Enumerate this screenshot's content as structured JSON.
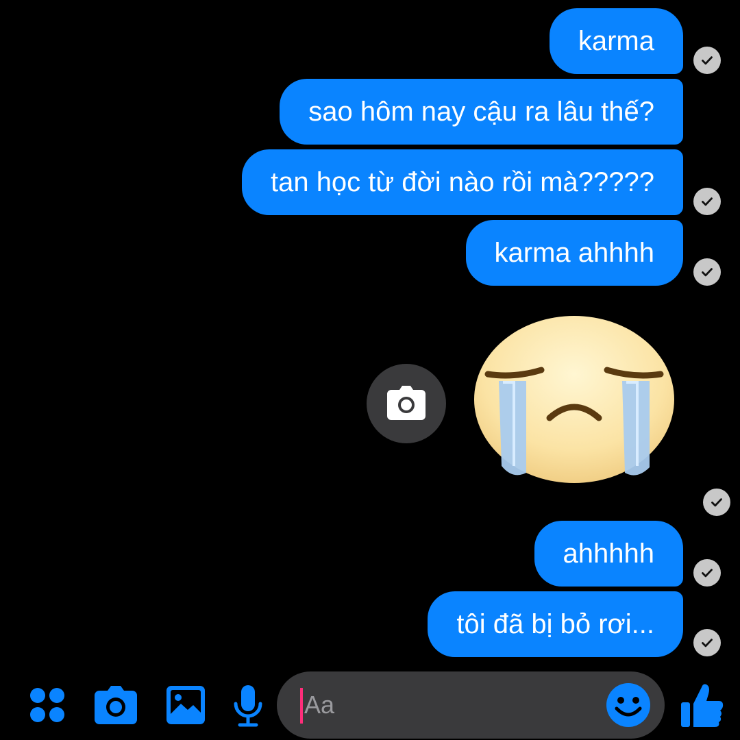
{
  "colors": {
    "background": "#000000",
    "bubble": "#0a84ff",
    "accent": "#0a84ff",
    "receipt": "#c8c8c8",
    "input_bg": "#3a3a3c"
  },
  "messages": [
    {
      "text": "karma"
    },
    {
      "text": "sao hôm nay cậu ra lâu thế?"
    },
    {
      "text": "tan học từ đời nào rồi mà?????"
    },
    {
      "text": "karma ahhhh"
    },
    {
      "text": "ahhhhh"
    },
    {
      "text": "tôi đã bị bỏ rơi..."
    }
  ],
  "sticker": {
    "icon": "crying-face-sticker"
  },
  "camera_overlay": {
    "icon": "camera-icon"
  },
  "composer": {
    "placeholder": "Aa",
    "icons": [
      "apps-icon",
      "camera-icon",
      "gallery-icon",
      "microphone-icon",
      "emoji-icon",
      "thumbs-up-icon"
    ]
  }
}
